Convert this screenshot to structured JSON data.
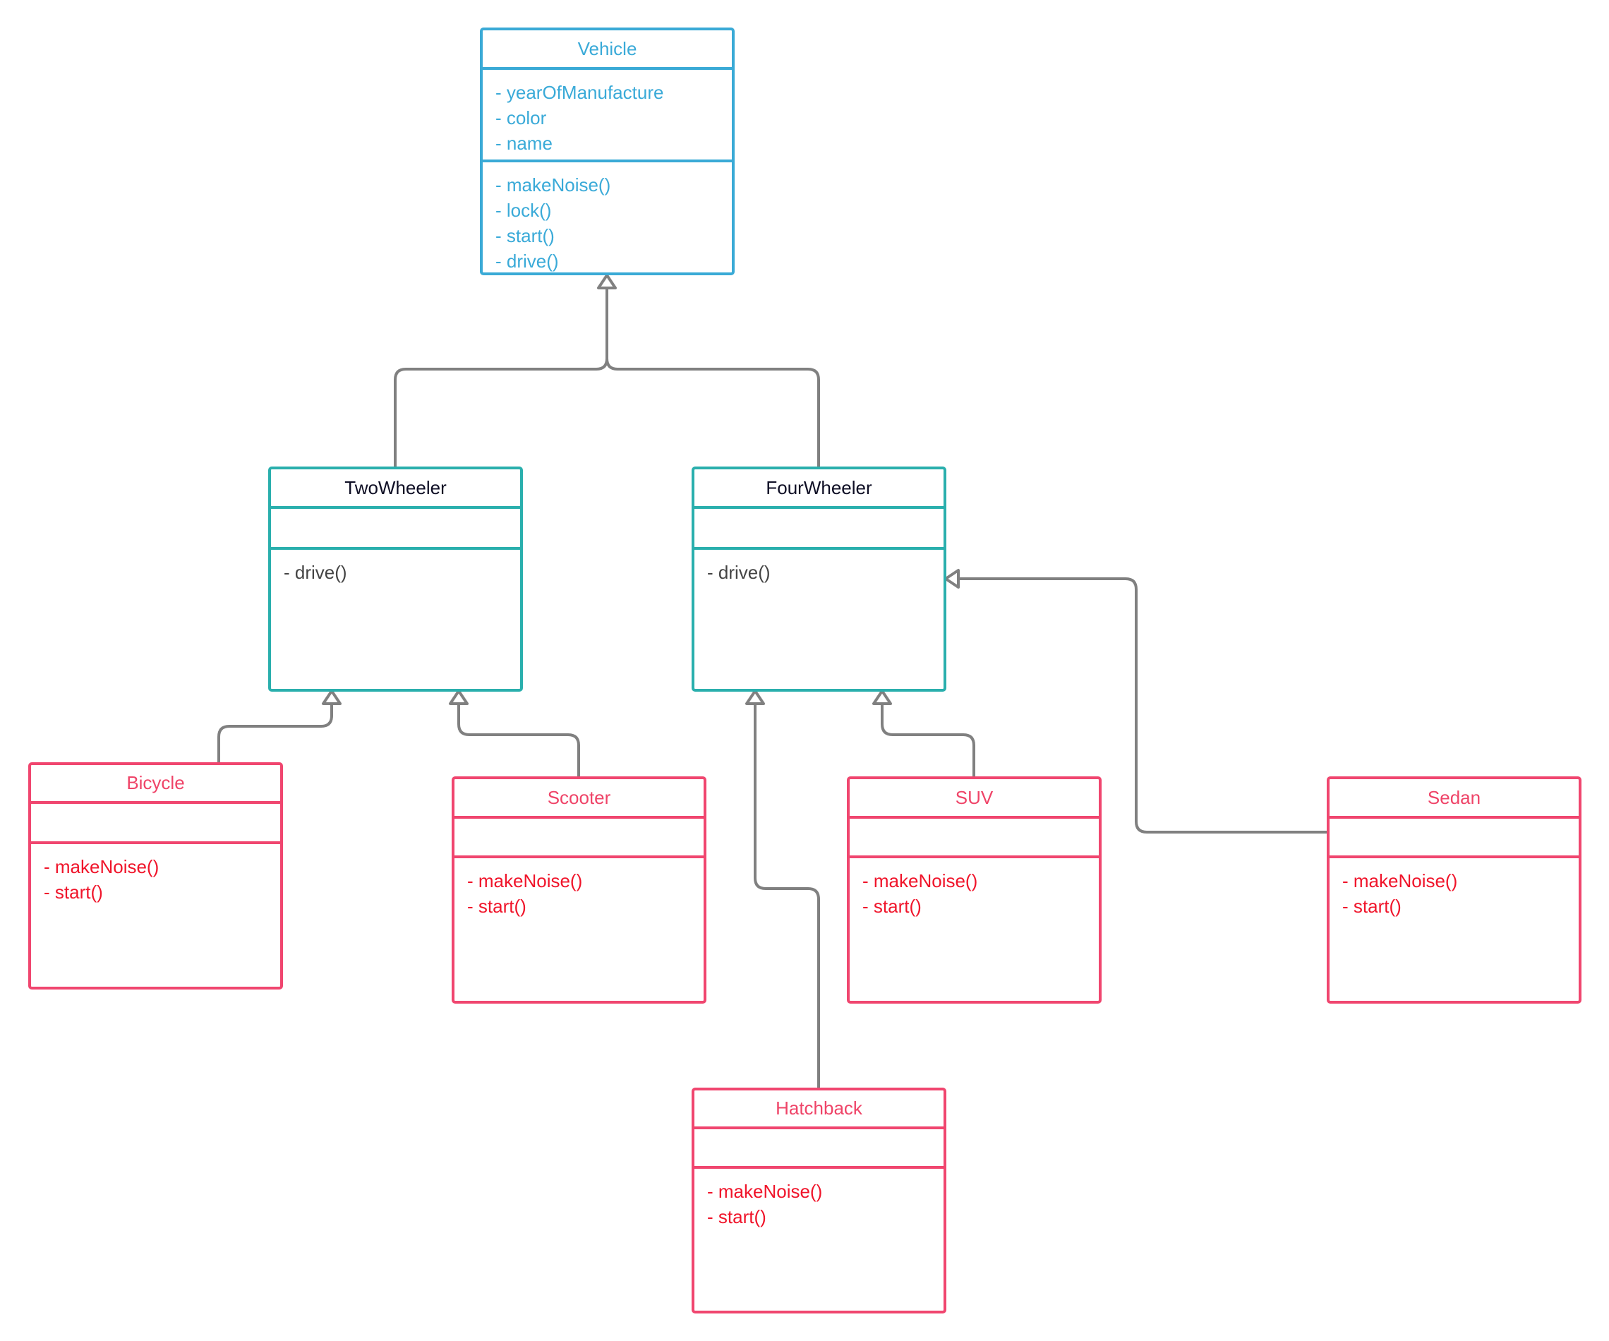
{
  "diagram": {
    "type": "UML class diagram",
    "colors": {
      "base": "#3aaad6",
      "intermediate": "#2aafad",
      "leaf": "#f0466f",
      "leaf_method_text": "#f0142a",
      "connector": "#808080"
    },
    "classes": {
      "vehicle": {
        "name": "Vehicle",
        "attributes": [
          "- yearOfManufacture",
          "- color",
          "- name"
        ],
        "methods": [
          "- makeNoise()",
          "- lock()",
          "- start()",
          "- drive()"
        ]
      },
      "twowheeler": {
        "name": "TwoWheeler",
        "attributes": [],
        "methods": [
          "- drive()"
        ]
      },
      "fourwheeler": {
        "name": "FourWheeler",
        "attributes": [],
        "methods": [
          "- drive()"
        ]
      },
      "bicycle": {
        "name": "Bicycle",
        "attributes": [],
        "methods": [
          "- makeNoise()",
          "- start()"
        ]
      },
      "scooter": {
        "name": "Scooter",
        "attributes": [],
        "methods": [
          "- makeNoise()",
          "- start()"
        ]
      },
      "suv": {
        "name": "SUV",
        "attributes": [],
        "methods": [
          "- makeNoise()",
          "- start()"
        ]
      },
      "sedan": {
        "name": "Sedan",
        "attributes": [],
        "methods": [
          "- makeNoise()",
          "- start()"
        ]
      },
      "hatchback": {
        "name": "Hatchback",
        "attributes": [],
        "methods": [
          "- makeNoise()",
          "- start()"
        ]
      }
    },
    "relationships": [
      {
        "type": "generalization",
        "from": "TwoWheeler",
        "to": "Vehicle"
      },
      {
        "type": "generalization",
        "from": "FourWheeler",
        "to": "Vehicle"
      },
      {
        "type": "generalization",
        "from": "Bicycle",
        "to": "TwoWheeler"
      },
      {
        "type": "generalization",
        "from": "Scooter",
        "to": "TwoWheeler"
      },
      {
        "type": "generalization",
        "from": "Hatchback",
        "to": "FourWheeler"
      },
      {
        "type": "generalization",
        "from": "SUV",
        "to": "FourWheeler"
      },
      {
        "type": "generalization",
        "from": "Sedan",
        "to": "FourWheeler"
      }
    ]
  }
}
